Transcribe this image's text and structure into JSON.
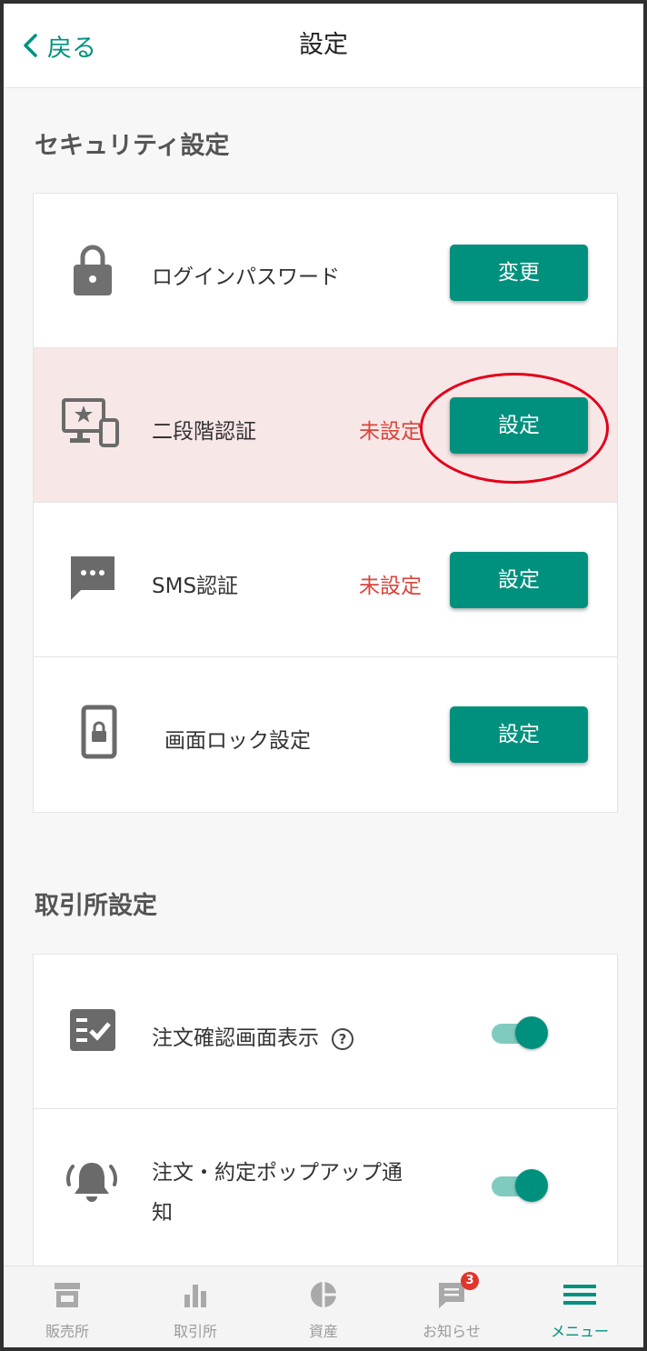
{
  "header": {
    "back_label": "戻る",
    "title": "設定"
  },
  "security": {
    "section_title": "セキュリティ設定",
    "rows": [
      {
        "label": "ログインパスワード",
        "status": "",
        "button": "変更",
        "icon": "lock-icon"
      },
      {
        "label": "二段階認証",
        "status": "未設定",
        "button": "設定",
        "icon": "two-factor-device-icon",
        "highlighted": true
      },
      {
        "label": "SMS認証",
        "status": "未設定",
        "button": "設定",
        "icon": "sms-icon"
      },
      {
        "label": "画面ロック設定",
        "status": "",
        "button": "設定",
        "icon": "screen-lock-icon"
      }
    ]
  },
  "exchange": {
    "section_title": "取引所設定",
    "rows": [
      {
        "label": "注文確認画面表示",
        "help_icon": "?",
        "toggle_on": true,
        "icon": "order-confirm-icon"
      },
      {
        "label_line1": "注文・約定ポップアップ通",
        "label_line2": "知",
        "toggle_on": true,
        "icon": "bell-icon"
      }
    ]
  },
  "bottom_nav": {
    "items": [
      {
        "label": "販売所",
        "icon": "store-icon",
        "active": false
      },
      {
        "label": "取引所",
        "icon": "bar-chart-icon",
        "active": false
      },
      {
        "label": "資産",
        "icon": "pie-chart-icon",
        "active": false
      },
      {
        "label": "お知らせ",
        "icon": "notification-icon",
        "active": false,
        "badge": "3"
      },
      {
        "label": "メニュー",
        "icon": "hamburger-menu-icon",
        "active": true
      }
    ]
  },
  "colors": {
    "accent": "#00917e",
    "warning_text": "#d9453c",
    "warning_bg": "#f8e7e7",
    "annotation": "#e2001a"
  }
}
